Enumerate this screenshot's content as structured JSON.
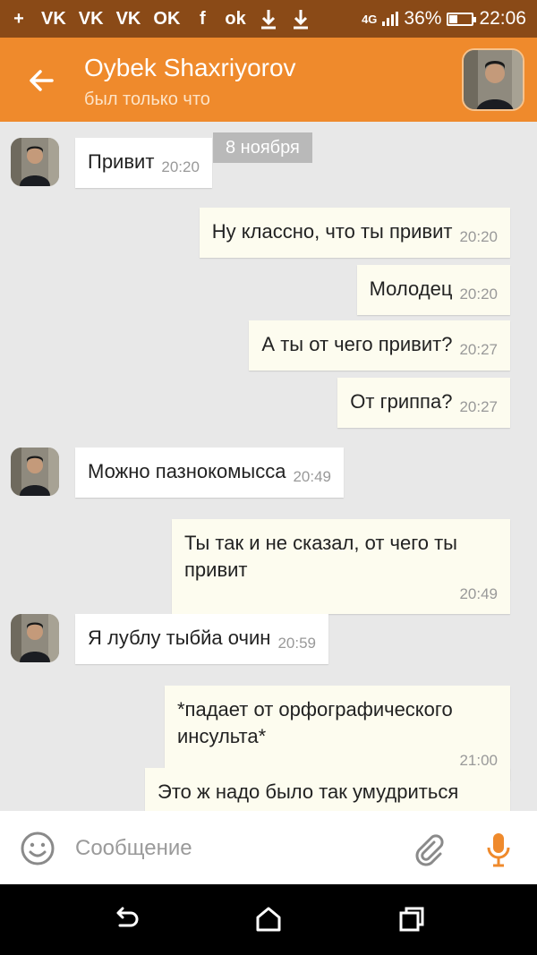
{
  "status_bar": {
    "left_icons": [
      "+",
      "VK",
      "VK",
      "VK",
      "OK",
      "f",
      "ok",
      "download-icon",
      "download-icon"
    ],
    "network": "4G",
    "battery_percent": "36%",
    "battery_level": 0.36,
    "time": "22:06"
  },
  "header": {
    "name": "Oybek Shaxriyorov",
    "status": "был только что"
  },
  "chat": {
    "date": "8 ноября",
    "messages": [
      {
        "dir": "in",
        "text": "Привит",
        "time": "20:20"
      },
      {
        "dir": "out",
        "text": "Ну классно, что ты привит",
        "time": "20:20"
      },
      {
        "dir": "out",
        "text": "Молодец",
        "time": "20:20"
      },
      {
        "dir": "out",
        "text": "А ты от чего привит?",
        "time": "20:27"
      },
      {
        "dir": "out",
        "text": "От гриппа?",
        "time": "20:27"
      },
      {
        "dir": "in",
        "text": "Можно пазнокомысса",
        "time": "20:49"
      },
      {
        "dir": "out",
        "text": "Ты так и не сказал, от чего ты привит",
        "time": "20:49"
      },
      {
        "dir": "in",
        "text": "Я лублу тыбйа очин",
        "time": "20:59"
      },
      {
        "dir": "out",
        "text": "*падает от орфографического инсульта*",
        "time": "21:00"
      },
      {
        "dir": "out",
        "text": "Это ж надо было так умудриться",
        "time": ""
      }
    ]
  },
  "composer": {
    "placeholder": "Сообщение"
  },
  "colors": {
    "header": "#ef8a2c",
    "status_bar": "#8a4a17",
    "chat_background": "#e8e8e8",
    "outgoing_bubble": "#fdfcef",
    "incoming_bubble": "#ffffff",
    "accent": "#ef8a2c"
  },
  "icons": {
    "back": "arrow-left-icon",
    "emoji": "smile-icon",
    "attach": "paperclip-icon",
    "mic": "microphone-icon",
    "nav": [
      "back-nav-icon",
      "home-icon",
      "recents-icon"
    ]
  }
}
